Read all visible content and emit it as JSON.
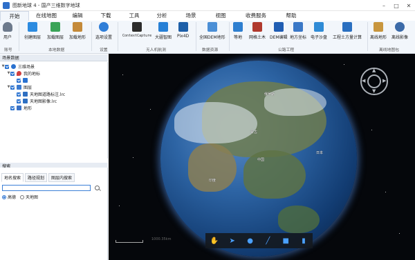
{
  "window": {
    "title": "图新地球 4 - 国产三维数字地球",
    "app_icon": "globe-app-icon"
  },
  "menubar": {
    "items": [
      "开始",
      "在线地图",
      "编辑",
      "下载",
      "工具",
      "分析",
      "场景",
      "视图",
      "收费服务",
      "帮助"
    ],
    "active": "开始"
  },
  "ribbon": {
    "buttons": {
      "user": "用户",
      "create_layer": "创建图层",
      "load_layer": "加载图层",
      "load_terrain": "加载地形",
      "options": "选项设置",
      "context_capture": "ContextCapture",
      "dajiang_zhitu": "大疆智图",
      "pix4d": "Pix4D",
      "national_dem": "全国DEM地形",
      "contour": "等地",
      "earthwork": "网格土木",
      "dem_edit": "DEM编辑",
      "map_coords": "地方坐标",
      "e_sandtable": "电子沙盘",
      "earthwork_calc": "工程土方量计算",
      "offline_terrain": "离线地形",
      "offline_image": "离线影像"
    },
    "groups": {
      "account": "账号",
      "local_data": "本地数据",
      "settings": "设置",
      "uav": "无人机航测",
      "data_res": "数据资源",
      "road": "公路工程",
      "offline_pkg": "离线地图包"
    }
  },
  "scene_panel": {
    "title": "场景数据",
    "tree": [
      {
        "label": "三维场景",
        "icon": "globe-icon",
        "level": 0
      },
      {
        "label": "我的地标",
        "icon": "placemark-icon",
        "level": 1
      },
      {
        "label": "",
        "icon": "folder-icon",
        "level": 2
      },
      {
        "label": "图层",
        "icon": "layer-icon",
        "level": 1
      },
      {
        "label": "天地图道路标注.lrc",
        "icon": "file-icon",
        "level": 2
      },
      {
        "label": "天地图影像.lrc",
        "icon": "file-icon",
        "level": 2
      },
      {
        "label": "地形",
        "icon": "terrain-icon",
        "level": 1
      }
    ]
  },
  "search_panel": {
    "title": "搜索",
    "tabs": [
      "地名搜索",
      "路径规划",
      "图层内搜索"
    ],
    "active_tab": "地名搜索",
    "input_value": "",
    "providers": [
      "高德",
      "天地图"
    ],
    "selected_provider": "高德"
  },
  "viewport": {
    "scale_text": "1000.35km",
    "labels": [
      "中国",
      "俄罗斯",
      "蒙古",
      "印度",
      "日本"
    ],
    "tools": [
      "hand-tool-icon",
      "pointer-icon",
      "placemark-icon",
      "line-icon",
      "polygon-icon",
      "chart-icon"
    ]
  },
  "colors": {
    "accent": "#2a72d0",
    "ribbon_bg": "#f2f6fb",
    "space": "#05070b"
  }
}
